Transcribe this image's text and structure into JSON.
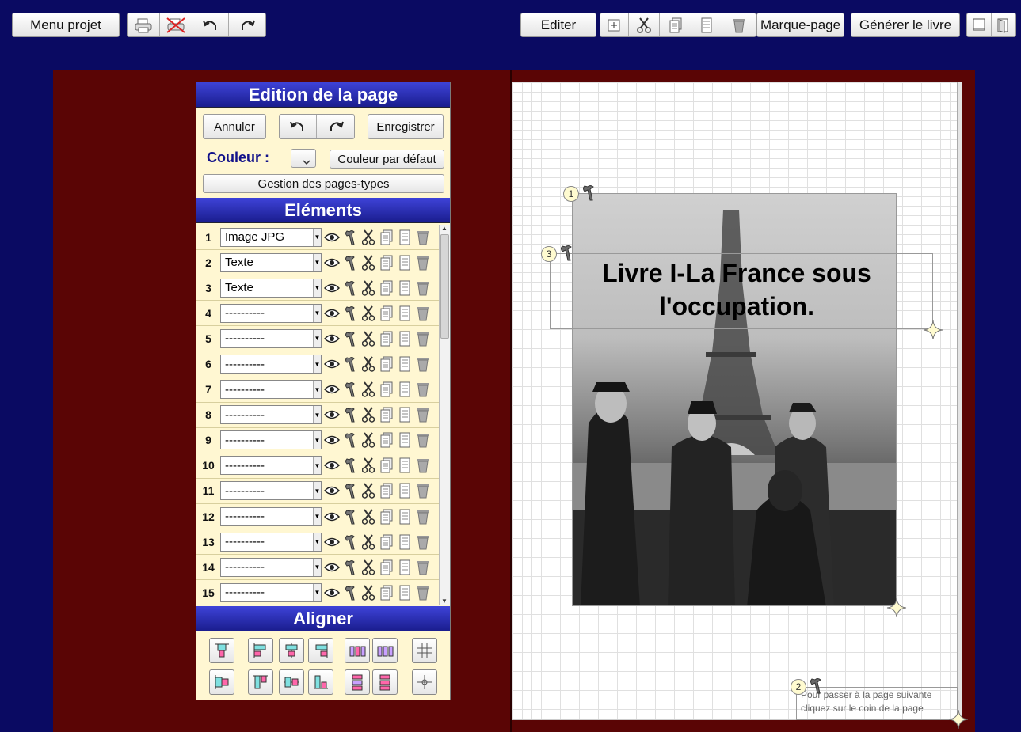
{
  "toolbar": {
    "menu_label": "Menu projet",
    "edit_label": "Editer",
    "bookmark_label": "Marque-page",
    "generate_label": "Générer le livre"
  },
  "panel": {
    "title": "Edition de la page",
    "cancel_label": "Annuler",
    "save_label": "Enregistrer",
    "color_label": "Couleur :",
    "default_color_label": "Couleur par défaut",
    "page_types_label": "Gestion des pages-types",
    "elements_title": "Eléments",
    "align_title": "Aligner"
  },
  "elements": [
    {
      "num": "1",
      "type": "Image JPG"
    },
    {
      "num": "2",
      "type": "Texte"
    },
    {
      "num": "3",
      "type": "Texte"
    },
    {
      "num": "4",
      "type": "----------"
    },
    {
      "num": "5",
      "type": "----------"
    },
    {
      "num": "6",
      "type": "----------"
    },
    {
      "num": "7",
      "type": "----------"
    },
    {
      "num": "8",
      "type": "----------"
    },
    {
      "num": "9",
      "type": "----------"
    },
    {
      "num": "10",
      "type": "----------"
    },
    {
      "num": "11",
      "type": "----------"
    },
    {
      "num": "12",
      "type": "----------"
    },
    {
      "num": "13",
      "type": "----------"
    },
    {
      "num": "14",
      "type": "----------"
    },
    {
      "num": "15",
      "type": "----------"
    }
  ],
  "page": {
    "title_line1": "Livre I-La France sous",
    "title_line2": "l'occupation.",
    "badge_image": "1",
    "badge_title": "3",
    "badge_footer": "2",
    "footer_line1": "Pour passer à la page suivante",
    "footer_line2": "cliquez sur le coin de la page"
  },
  "colors": {
    "background": "#0a0a62",
    "book": "#5a0505",
    "panel": "#fff7d2",
    "header": "#2a2fb8",
    "couleur_label": "#12128a"
  }
}
